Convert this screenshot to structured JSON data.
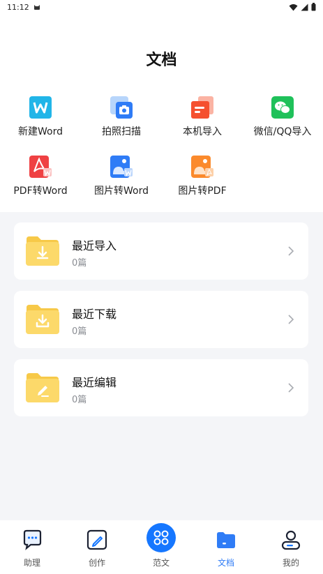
{
  "status": {
    "time": "11:12"
  },
  "page": {
    "title": "文档"
  },
  "tools": [
    {
      "label": "新建Word",
      "icon": "word-icon"
    },
    {
      "label": "拍照扫描",
      "icon": "camera-scan-icon"
    },
    {
      "label": "本机导入",
      "icon": "local-import-icon"
    },
    {
      "label": "微信/QQ导入",
      "icon": "wechat-icon"
    },
    {
      "label": "PDF转Word",
      "icon": "pdf-to-word-icon"
    },
    {
      "label": "图片转Word",
      "icon": "image-to-word-icon"
    },
    {
      "label": "图片转PDF",
      "icon": "image-to-pdf-icon"
    }
  ],
  "folders": [
    {
      "title": "最近导入",
      "count": "0篇",
      "icon": "import-folder-icon"
    },
    {
      "title": "最近下载",
      "count": "0篇",
      "icon": "download-folder-icon"
    },
    {
      "title": "最近编辑",
      "count": "0篇",
      "icon": "edit-folder-icon"
    }
  ],
  "tabs": [
    {
      "label": "助理",
      "icon": "chat-icon"
    },
    {
      "label": "创作",
      "icon": "edit-icon"
    },
    {
      "label": "范文",
      "icon": "grid-icon"
    },
    {
      "label": "文档",
      "icon": "folder-icon",
      "active": true
    },
    {
      "label": "我的",
      "icon": "user-icon"
    }
  ],
  "colors": {
    "accent": "#2f7cf6",
    "center_button": "#1677ff",
    "folder_yellow": "#fcd75a",
    "background": "#f4f5f8"
  }
}
